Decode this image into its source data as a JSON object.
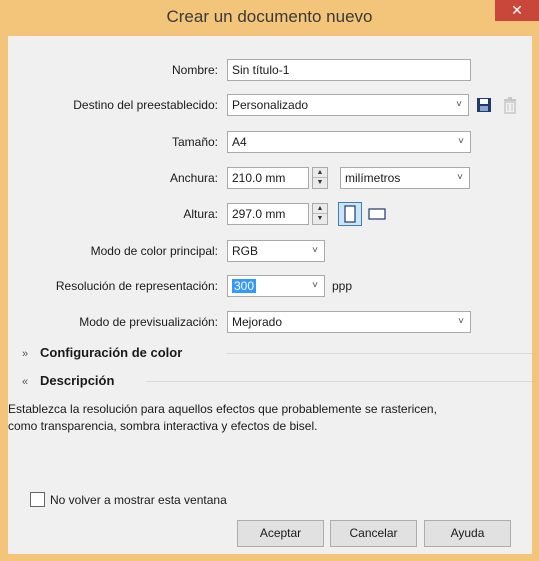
{
  "window": {
    "title": "Crear un documento nuevo",
    "close_glyph": "✕"
  },
  "form": {
    "name_label": "Nombre:",
    "name_value": "Sin título-1",
    "preset_label": "Destino del preestablecido:",
    "preset_value": "Personalizado",
    "size_label": "Tamaño:",
    "size_value": "A4",
    "width_label": "Anchura:",
    "width_value": "210.0 mm",
    "units_value": "milímetros",
    "height_label": "Altura:",
    "height_value": "297.0 mm",
    "color_mode_label": "Modo de color principal:",
    "color_mode_value": "RGB",
    "resolution_label": "Resolución de representación:",
    "resolution_value": "300",
    "resolution_unit": "ppp",
    "preview_label": "Modo de previsualización:",
    "preview_value": "Mejorado"
  },
  "sections": {
    "color_config": "Configuración de color",
    "description": "Descripción"
  },
  "description_text_1": "Establezca la resolución para aquellos efectos que probablemente se rastericen,",
  "description_text_2": "como transparencia, sombra interactiva y efectos de bisel.",
  "dont_show_label": "No volver a mostrar esta ventana",
  "buttons": {
    "ok": "Aceptar",
    "cancel": "Cancelar",
    "help": "Ayuda"
  },
  "icons": {
    "chevron": "˅",
    "save": "floppy-disk-icon",
    "delete": "trash-icon",
    "portrait": "portrait-page-icon",
    "landscape": "landscape-page-icon",
    "collapse": "»",
    "expand": "«"
  },
  "colors": {
    "titlebar": "#f2c57a",
    "close": "#c9473a",
    "selection": "#3399ff",
    "toggle_active": "#cce4f7"
  }
}
